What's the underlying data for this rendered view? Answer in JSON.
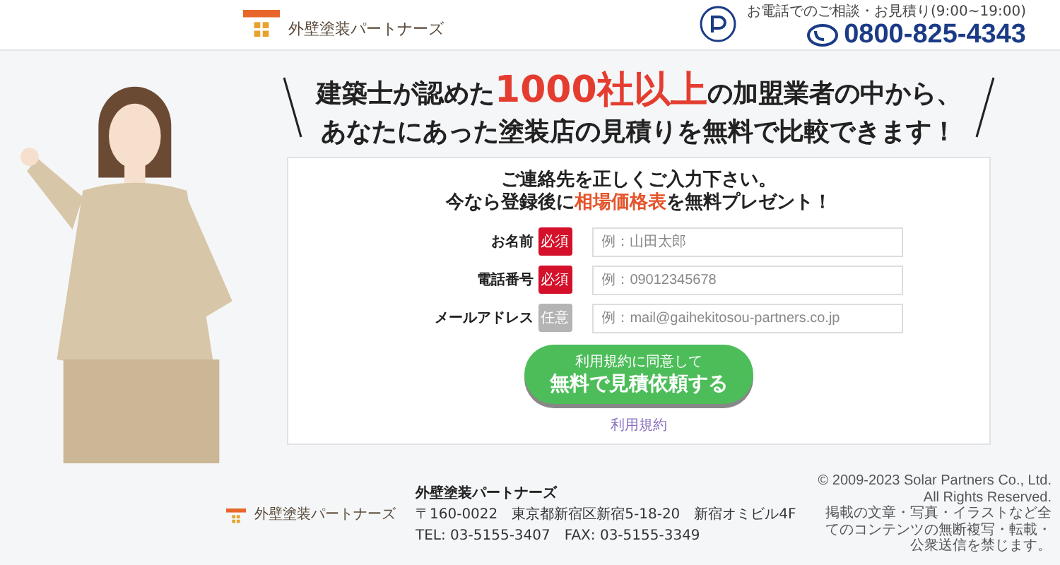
{
  "header": {
    "logo_text": "外壁塗装パートナーズ",
    "phone_note": "お電話でのご相談・お見積り(9:00~19:00)",
    "phone": "0800-825-4343"
  },
  "headline": {
    "line1_before": "建築士が認めた",
    "line1_emphasis": "1000社以上",
    "line1_after": "の加盟業者の中から、",
    "line2": "あなたにあった塗装店の見積りを無料で比較できます！"
  },
  "form": {
    "intro_line1": "ご連絡先を正しくご入力下さい。",
    "intro_line2": "今なら登録後に**相場価格表**を無料プレゼント！",
    "fields": [
      {
        "label": "お名前",
        "kind": "required",
        "badge": "必須",
        "placeholder": "例：山田太郎"
      },
      {
        "label": "電話番号",
        "kind": "required",
        "badge": "必須",
        "placeholder": "例：09012345678"
      },
      {
        "label": "メールアドレス",
        "kind": "optional",
        "badge": "任意",
        "placeholder": "例：mail@gaihekitosou-partners.co.jp"
      }
    ],
    "submit_note": "利用規約に同意して",
    "submit_label": "無料で見積依頼する",
    "terms_link": "利用規約"
  },
  "footer": {
    "logo_text": "外壁塗装パートナーズ",
    "company": "外壁塗装パートナーズ",
    "address": "〒160-0022　東京都新宿区新宿5-18-20　新宿オミビル4F",
    "contact": "TEL: 03-5155-3407　FAX: 03-5155-3349",
    "copyright": "© 2009-2023 Solar Partners Co., Ltd. All Rights Reserved.",
    "notice": "掲載の文章・写真・イラストなど全てのコンテンツの無断複写・転載・公衆送信を禁じます。"
  }
}
